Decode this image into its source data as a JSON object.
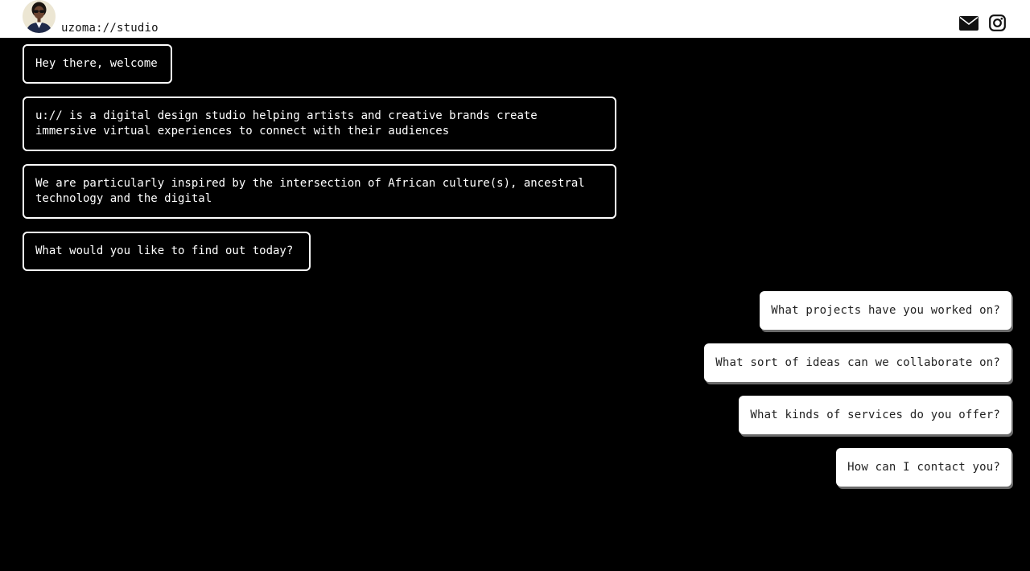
{
  "header": {
    "brand": "uzoma://studio",
    "avatar_icon": "avatar",
    "mail_icon": "mail-icon",
    "instagram_icon": "instagram-icon",
    "background": "#ffffff"
  },
  "chat": {
    "bot_messages": [
      "Hey there, welcome",
      "u:// is a digital design studio helping artists and creative brands create immersive virtual experiences to connect with their audiences",
      "We are particularly inspired by the intersection of African culture(s), ancestral technology and the digital",
      "What would you like to find out today?"
    ],
    "quick_replies": [
      "What projects have you worked on?",
      "What sort of ideas can we collaborate on?",
      "What kinds of services do you offer?",
      "How can I contact you?"
    ]
  },
  "colors": {
    "background": "#000000",
    "bubble_border": "#ffffff",
    "reply_background": "#ffffff",
    "reply_shadow": "#6b6b6b"
  }
}
